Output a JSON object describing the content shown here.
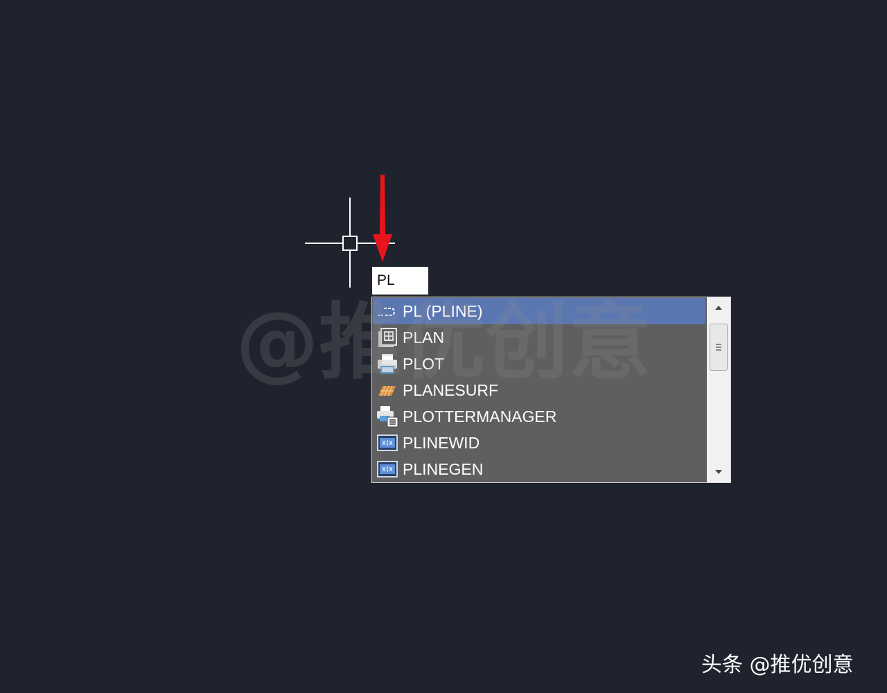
{
  "command_input": {
    "value": "PL"
  },
  "autocomplete": {
    "items": [
      {
        "label": "PL (PLINE)",
        "icon": "polyline-icon",
        "selected": true
      },
      {
        "label": "PLAN",
        "icon": "plan-icon",
        "selected": false
      },
      {
        "label": "PLOT",
        "icon": "printer-icon",
        "selected": false
      },
      {
        "label": "PLANESURF",
        "icon": "planar-surface-icon",
        "selected": false
      },
      {
        "label": "PLOTTERMANAGER",
        "icon": "plotter-manager-icon",
        "selected": false
      },
      {
        "label": "PLINEWID",
        "icon": "system-variable-icon",
        "selected": false
      },
      {
        "label": "PLINEGEN",
        "icon": "system-variable-icon",
        "selected": false
      }
    ]
  },
  "watermark": {
    "text": "@推优创意"
  },
  "credit": {
    "text": "头条 @推优创意"
  },
  "colors": {
    "background": "#1e232d",
    "list_background": "#5f5f5f",
    "selected_row": "#5a77b2",
    "arrow": "#e8141b"
  }
}
